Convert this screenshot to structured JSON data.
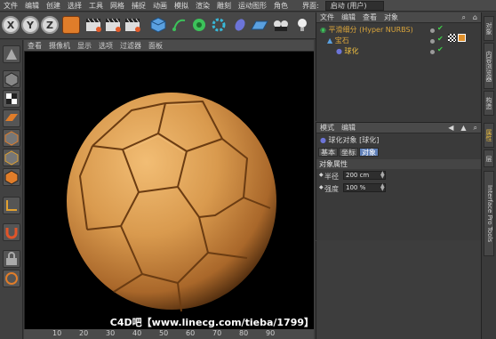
{
  "menubar": {
    "items": [
      "文件",
      "编辑",
      "创建",
      "选择",
      "工具",
      "网格",
      "捕捉",
      "动画",
      "模拟",
      "渲染",
      "雕刻",
      "运动图形",
      "角色"
    ],
    "layout_label": "界面:",
    "layout_value": "启动 (用户)"
  },
  "toolbar": {
    "axis_x": "X",
    "axis_y": "Y",
    "axis_z": "Z"
  },
  "viewport": {
    "menu": [
      "查看",
      "摄像机",
      "显示",
      "选项",
      "过滤器",
      "面板"
    ],
    "ruler_ticks": [
      "10",
      "20",
      "30",
      "40",
      "50",
      "60",
      "70",
      "80",
      "90"
    ],
    "watermark": "C4D吧【www.linecg.com/tieba/1799】"
  },
  "object_manager": {
    "menu": [
      "文件",
      "编辑",
      "查看",
      "对象"
    ],
    "objects": [
      {
        "name": "平滑细分 (Hyper NURBS)",
        "color": "#d9a43a"
      },
      {
        "name": "宝石",
        "color": "#d9a43a"
      },
      {
        "name": "球化",
        "color": "#f0c040"
      }
    ]
  },
  "attribute_manager": {
    "menu": [
      "模式",
      "编辑"
    ],
    "object_title": "球化对象 [球化]",
    "tabs": [
      "基本",
      "坐标",
      "对象"
    ],
    "active_tab": "对象",
    "section": "对象属性",
    "props": [
      {
        "label": "半径",
        "value": "200 cm"
      },
      {
        "label": "强度",
        "value": "100 %"
      }
    ]
  },
  "right_tabs": [
    "对象",
    "内容浏览器",
    "构造",
    "属性",
    "层",
    "Interface Pro Tools"
  ],
  "colors": {
    "accent": "#5e7fb8",
    "ball": "#d99a4e",
    "selected_object": "#f0c040"
  }
}
